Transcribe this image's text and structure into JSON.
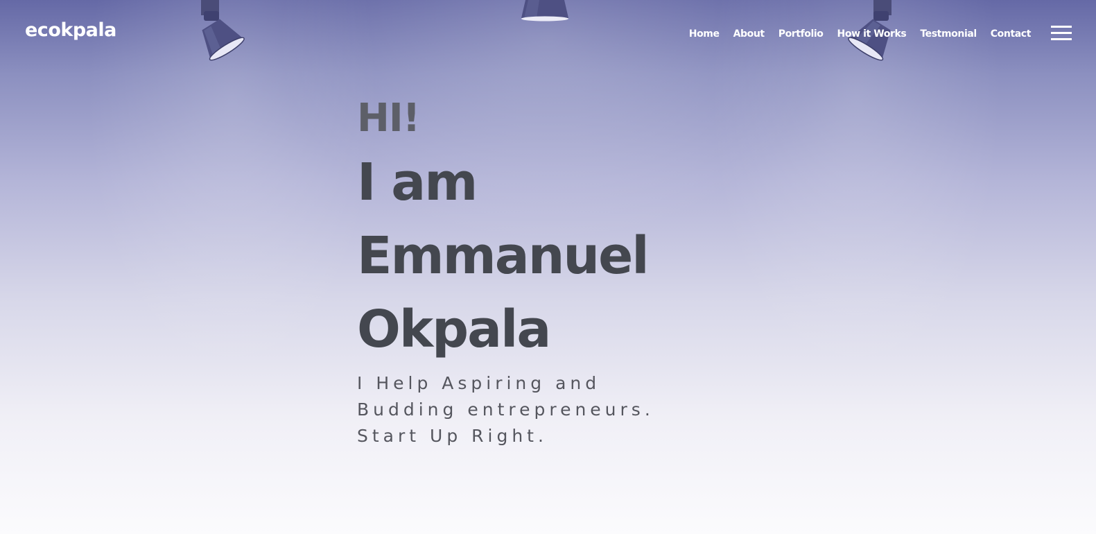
{
  "brand": {
    "logo_text": "ecokpala"
  },
  "nav": {
    "items": [
      {
        "label": "Home"
      },
      {
        "label": "About"
      },
      {
        "label": "Portfolio"
      },
      {
        "label": "How it Works"
      },
      {
        "label": "Testmonial"
      },
      {
        "label": "Contact"
      }
    ],
    "menu_icon": "hamburger-menu-icon"
  },
  "hero": {
    "greeting": "HI!",
    "line1": "I am",
    "line2": "Emmanuel",
    "line3": "Okpala",
    "tagline": "I Help Aspiring and Budding entrepreneurs. Start Up Right."
  },
  "decor": {
    "lamps": [
      "spotlight-left-icon",
      "spotlight-center-icon",
      "spotlight-right-icon"
    ]
  },
  "colors": {
    "background_top": "#6569a6",
    "background_bottom": "#fbfbfd",
    "heading": "#44474f",
    "greeting": "#5d5f68",
    "nav_text": "#ffffff",
    "lamp_body": "#4c4e7c"
  }
}
